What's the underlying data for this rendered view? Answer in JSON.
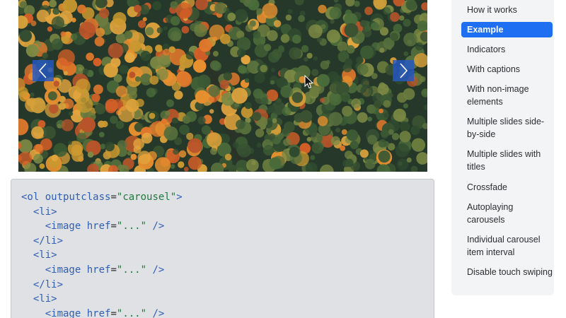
{
  "carousel": {
    "prev_icon": "chevron-left-icon",
    "next_icon": "chevron-right-icon",
    "accent": "#2558c4"
  },
  "code": {
    "lines": [
      [
        {
          "t": "tag",
          "v": "<ol"
        },
        {
          "t": "punc",
          "v": " "
        },
        {
          "t": "attr",
          "v": "outputclass"
        },
        {
          "t": "punc",
          "v": "="
        },
        {
          "t": "str",
          "v": "\"carousel\""
        },
        {
          "t": "tag",
          "v": ">"
        }
      ],
      [
        {
          "t": "punc",
          "v": "  "
        },
        {
          "t": "tag",
          "v": "<li>"
        }
      ],
      [
        {
          "t": "punc",
          "v": "    "
        },
        {
          "t": "tag",
          "v": "<image"
        },
        {
          "t": "punc",
          "v": " "
        },
        {
          "t": "attr",
          "v": "href"
        },
        {
          "t": "punc",
          "v": "="
        },
        {
          "t": "str",
          "v": "\"...\""
        },
        {
          "t": "punc",
          "v": " "
        },
        {
          "t": "tag",
          "v": "/>"
        }
      ],
      [
        {
          "t": "punc",
          "v": "  "
        },
        {
          "t": "tag",
          "v": "</li>"
        }
      ],
      [
        {
          "t": "punc",
          "v": "  "
        },
        {
          "t": "tag",
          "v": "<li>"
        }
      ],
      [
        {
          "t": "punc",
          "v": "    "
        },
        {
          "t": "tag",
          "v": "<image"
        },
        {
          "t": "punc",
          "v": " "
        },
        {
          "t": "attr",
          "v": "href"
        },
        {
          "t": "punc",
          "v": "="
        },
        {
          "t": "str",
          "v": "\"...\""
        },
        {
          "t": "punc",
          "v": " "
        },
        {
          "t": "tag",
          "v": "/>"
        }
      ],
      [
        {
          "t": "punc",
          "v": "  "
        },
        {
          "t": "tag",
          "v": "</li>"
        }
      ],
      [
        {
          "t": "punc",
          "v": "  "
        },
        {
          "t": "tag",
          "v": "<li>"
        }
      ],
      [
        {
          "t": "punc",
          "v": "    "
        },
        {
          "t": "tag",
          "v": "<image"
        },
        {
          "t": "punc",
          "v": " "
        },
        {
          "t": "attr",
          "v": "href"
        },
        {
          "t": "punc",
          "v": "="
        },
        {
          "t": "str",
          "v": "\"...\""
        },
        {
          "t": "punc",
          "v": " "
        },
        {
          "t": "tag",
          "v": "/>"
        }
      ]
    ]
  },
  "sidebar": {
    "active_color": "#1f6ff2",
    "items": [
      {
        "label": "How it works",
        "active": false
      },
      {
        "label": "Example",
        "active": true
      },
      {
        "label": "Indicators",
        "active": false
      },
      {
        "label": "With captions",
        "active": false
      },
      {
        "label": "With non-image elements",
        "active": false
      },
      {
        "label": "Multiple slides side-by-side",
        "active": false
      },
      {
        "label": "Multiple slides with titles",
        "active": false
      },
      {
        "label": "Crossfade",
        "active": false
      },
      {
        "label": "Autoplaying carousels",
        "active": false
      },
      {
        "label": "Individual carousel item interval",
        "active": false
      },
      {
        "label": "Disable touch swiping",
        "active": false
      }
    ]
  }
}
